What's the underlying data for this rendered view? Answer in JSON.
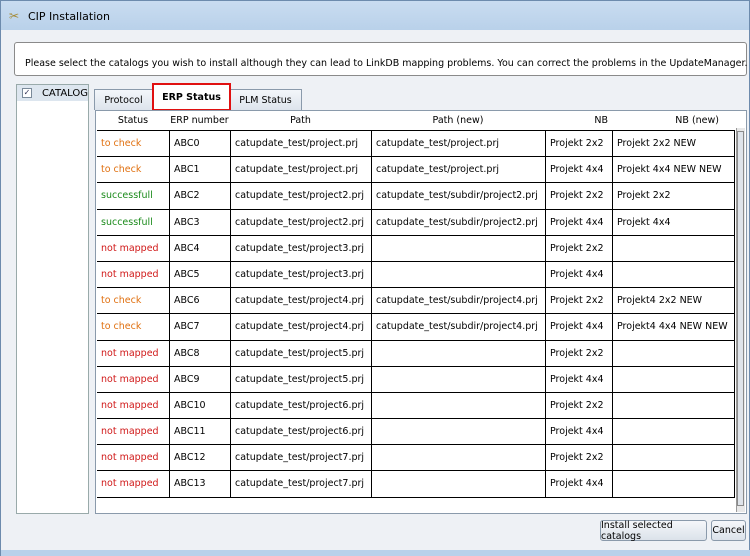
{
  "window": {
    "title": "CIP Installation"
  },
  "message": "Please select the catalogs you wish to install although they can lead to LinkDB mapping problems. You can correct the problems in the UpdateManager.",
  "catalog": {
    "label": "CATALOG",
    "checked": true
  },
  "tabs": [
    {
      "label": "Protocol"
    },
    {
      "label": "ERP Status",
      "active": true
    },
    {
      "label": "PLM Status"
    }
  ],
  "table": {
    "columns": [
      "Status",
      "ERP number",
      "Path",
      "Path (new)",
      "NB",
      "NB (new)"
    ],
    "rows": [
      [
        "to check",
        "ABC0",
        "catupdate_test/project.prj",
        "catupdate_test/project.prj",
        "Projekt 2x2",
        "Projekt 2x2 NEW"
      ],
      [
        "to check",
        "ABC1",
        "catupdate_test/project.prj",
        "catupdate_test/project.prj",
        "Projekt 4x4",
        "Projekt 4x4 NEW NEW"
      ],
      [
        "successfull",
        "ABC2",
        "catupdate_test/project2.prj",
        "catupdate_test/subdir/project2.prj",
        "Projekt 2x2",
        "Projekt 2x2"
      ],
      [
        "successfull",
        "ABC3",
        "catupdate_test/project2.prj",
        "catupdate_test/subdir/project2.prj",
        "Projekt 4x4",
        "Projekt 4x4"
      ],
      [
        "not mapped",
        "ABC4",
        "catupdate_test/project3.prj",
        "",
        "Projekt 2x2",
        ""
      ],
      [
        "not mapped",
        "ABC5",
        "catupdate_test/project3.prj",
        "",
        "Projekt 4x4",
        ""
      ],
      [
        "to check",
        "ABC6",
        "catupdate_test/project4.prj",
        "catupdate_test/subdir/project4.prj",
        "Projekt 2x2",
        "Projekt4 2x2 NEW"
      ],
      [
        "to check",
        "ABC7",
        "catupdate_test/project4.prj",
        "catupdate_test/subdir/project4.prj",
        "Projekt 4x4",
        "Projekt4 4x4 NEW NEW"
      ],
      [
        "not mapped",
        "ABC8",
        "catupdate_test/project5.prj",
        "",
        "Projekt 2x2",
        ""
      ],
      [
        "not mapped",
        "ABC9",
        "catupdate_test/project5.prj",
        "",
        "Projekt 4x4",
        ""
      ],
      [
        "not mapped",
        "ABC10",
        "catupdate_test/project6.prj",
        "",
        "Projekt 2x2",
        ""
      ],
      [
        "not mapped",
        "ABC11",
        "catupdate_test/project6.prj",
        "",
        "Projekt 4x4",
        ""
      ],
      [
        "not mapped",
        "ABC12",
        "catupdate_test/project7.prj",
        "",
        "Projekt 2x2",
        ""
      ],
      [
        "not mapped",
        "ABC13",
        "catupdate_test/project7.prj",
        "",
        "Projekt 4x4",
        ""
      ]
    ]
  },
  "status_colors": {
    "to check": "#e07010",
    "successfull": "#1a8a1a",
    "not mapped": "#d01818"
  },
  "buttons": {
    "install": "Install selected catalogs",
    "cancel": "Cancel"
  }
}
